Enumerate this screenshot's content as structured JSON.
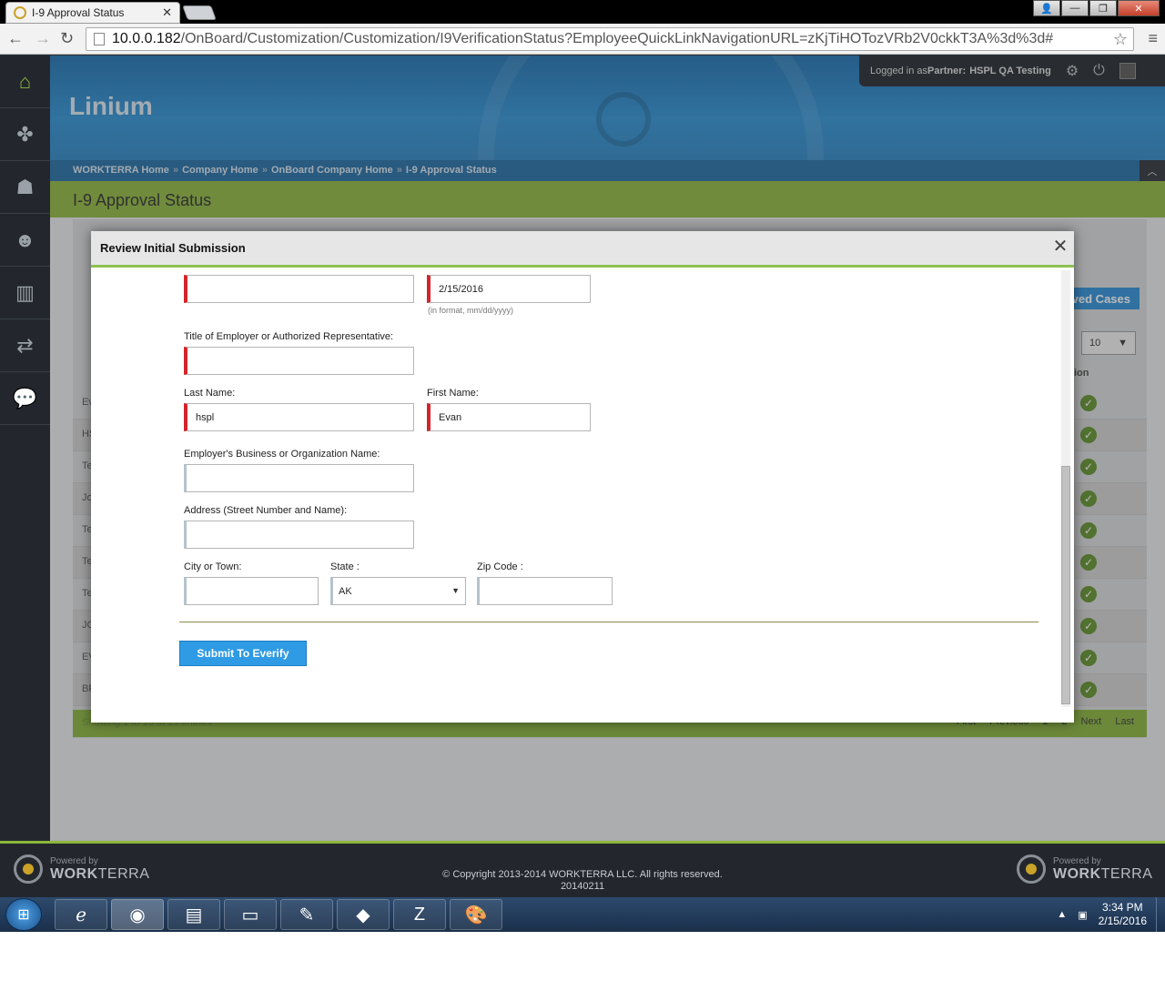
{
  "browser": {
    "tab_title": "I-9 Approval Status",
    "tab_close": "✕",
    "url_host": "10.0.0.182",
    "url_path": "/OnBoard/Customization/Customization/I9VerificationStatus?EmployeeQuickLinkNavigationURL=zKjTiHOTozVRb2V0ckkT3A%3d%3d#"
  },
  "header": {
    "brand": "Linium",
    "logged_in_prefix": "Logged in as ",
    "partner_label": "Partner:",
    "partner_name": "HSPL QA Testing"
  },
  "breadcrumb": {
    "items": [
      "WORKTERRA Home",
      "Company Home",
      "OnBoard Company Home",
      "I-9 Approval Status"
    ],
    "separator": "»"
  },
  "page": {
    "title": "I-9 Approval Status"
  },
  "background_table": {
    "cases_button": "ved Cases",
    "page_size": "10",
    "action_col": "ion",
    "row_prefixes": [
      "Ev",
      "HS",
      "Te",
      "Jo",
      "Te",
      "Te",
      "Te",
      "JO",
      "EV",
      "BF"
    ],
    "showing": "Showing 1 to 10 of 15 entries",
    "pager": [
      "First",
      "Previous",
      "1",
      "2",
      "Next",
      "Last"
    ]
  },
  "modal": {
    "title": "Review Initial Submission",
    "close": "✕",
    "fields": {
      "signature_value": "",
      "date_value": "2/15/2016",
      "date_hint": "(in format, mm/dd/yyyy)",
      "title_label": "Title of Employer or Authorized Representative:",
      "title_value": "",
      "last_name_label": "Last Name:",
      "last_name_value": "hspl",
      "first_name_label": "First Name:",
      "first_name_value": "Evan",
      "business_label": "Employer's Business or Organization Name:",
      "business_value": "",
      "address_label": "Address (Street Number and Name):",
      "address_value": "",
      "city_label": "City or Town:",
      "city_value": "",
      "state_label": "State :",
      "state_value": "AK",
      "zip_label": "Zip Code :",
      "zip_value": ""
    },
    "submit_label": "Submit To Everify"
  },
  "footer": {
    "powered_by": "Powered by",
    "brand_bold": "WORK",
    "brand_rest": "TERRA",
    "copyright": "© Copyright 2013-2014 WORKTERRA LLC. All rights reserved.",
    "build": "20140211"
  },
  "taskbar": {
    "time": "3:34 PM",
    "date": "2/15/2016"
  }
}
